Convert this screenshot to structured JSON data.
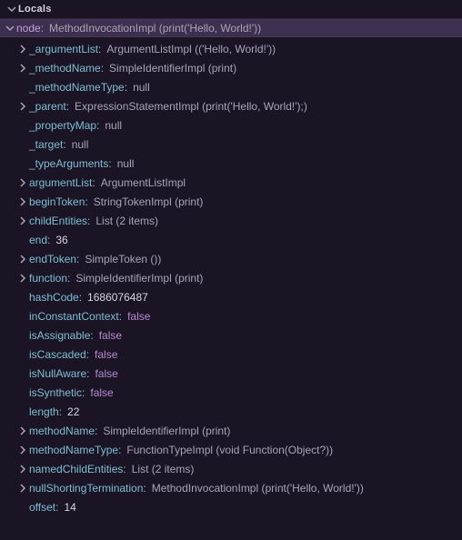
{
  "panel": {
    "title": "Locals"
  },
  "root": {
    "key": "node:",
    "value": "MethodInvocationImpl (print('Hello, World!'))"
  },
  "items": [
    {
      "expandable": true,
      "key": "_argumentList:",
      "value": "ArgumentListImpl (('Hello, World!'))",
      "type": "obj"
    },
    {
      "expandable": true,
      "key": "_methodName:",
      "value": "SimpleIdentifierImpl (print)",
      "type": "obj"
    },
    {
      "expandable": false,
      "key": "_methodNameType:",
      "value": "null",
      "type": "obj"
    },
    {
      "expandable": true,
      "key": "_parent:",
      "value": "ExpressionStatementImpl (print('Hello, World!');)",
      "type": "obj"
    },
    {
      "expandable": false,
      "key": "_propertyMap:",
      "value": "null",
      "type": "obj"
    },
    {
      "expandable": false,
      "key": "_target:",
      "value": "null",
      "type": "obj"
    },
    {
      "expandable": false,
      "key": "_typeArguments:",
      "value": "null",
      "type": "obj"
    },
    {
      "expandable": true,
      "key": "argumentList:",
      "value": "ArgumentListImpl",
      "type": "obj"
    },
    {
      "expandable": true,
      "key": "beginToken:",
      "value": "StringTokenImpl (print)",
      "type": "obj"
    },
    {
      "expandable": true,
      "key": "childEntities:",
      "value": "List (2 items)",
      "type": "obj"
    },
    {
      "expandable": false,
      "key": "end:",
      "value": "36",
      "type": "num"
    },
    {
      "expandable": true,
      "key": "endToken:",
      "value": "SimpleToken ())",
      "type": "obj"
    },
    {
      "expandable": true,
      "key": "function:",
      "value": "SimpleIdentifierImpl (print)",
      "type": "obj"
    },
    {
      "expandable": false,
      "key": "hashCode:",
      "value": "1686076487",
      "type": "num"
    },
    {
      "expandable": false,
      "key": "inConstantContext:",
      "value": "false",
      "type": "bool"
    },
    {
      "expandable": false,
      "key": "isAssignable:",
      "value": "false",
      "type": "bool"
    },
    {
      "expandable": false,
      "key": "isCascaded:",
      "value": "false",
      "type": "bool"
    },
    {
      "expandable": false,
      "key": "isNullAware:",
      "value": "false",
      "type": "bool"
    },
    {
      "expandable": false,
      "key": "isSynthetic:",
      "value": "false",
      "type": "bool"
    },
    {
      "expandable": false,
      "key": "length:",
      "value": "22",
      "type": "num"
    },
    {
      "expandable": true,
      "key": "methodName:",
      "value": "SimpleIdentifierImpl (print)",
      "type": "obj"
    },
    {
      "expandable": true,
      "key": "methodNameType:",
      "value": "FunctionTypeImpl (void Function(Object?))",
      "type": "obj"
    },
    {
      "expandable": true,
      "key": "namedChildEntities:",
      "value": "List (2 items)",
      "type": "obj"
    },
    {
      "expandable": true,
      "key": "nullShortingTermination:",
      "value": "MethodInvocationImpl (print('Hello, World!'))",
      "type": "obj"
    },
    {
      "expandable": false,
      "key": "offset:",
      "value": "14",
      "type": "num"
    }
  ]
}
